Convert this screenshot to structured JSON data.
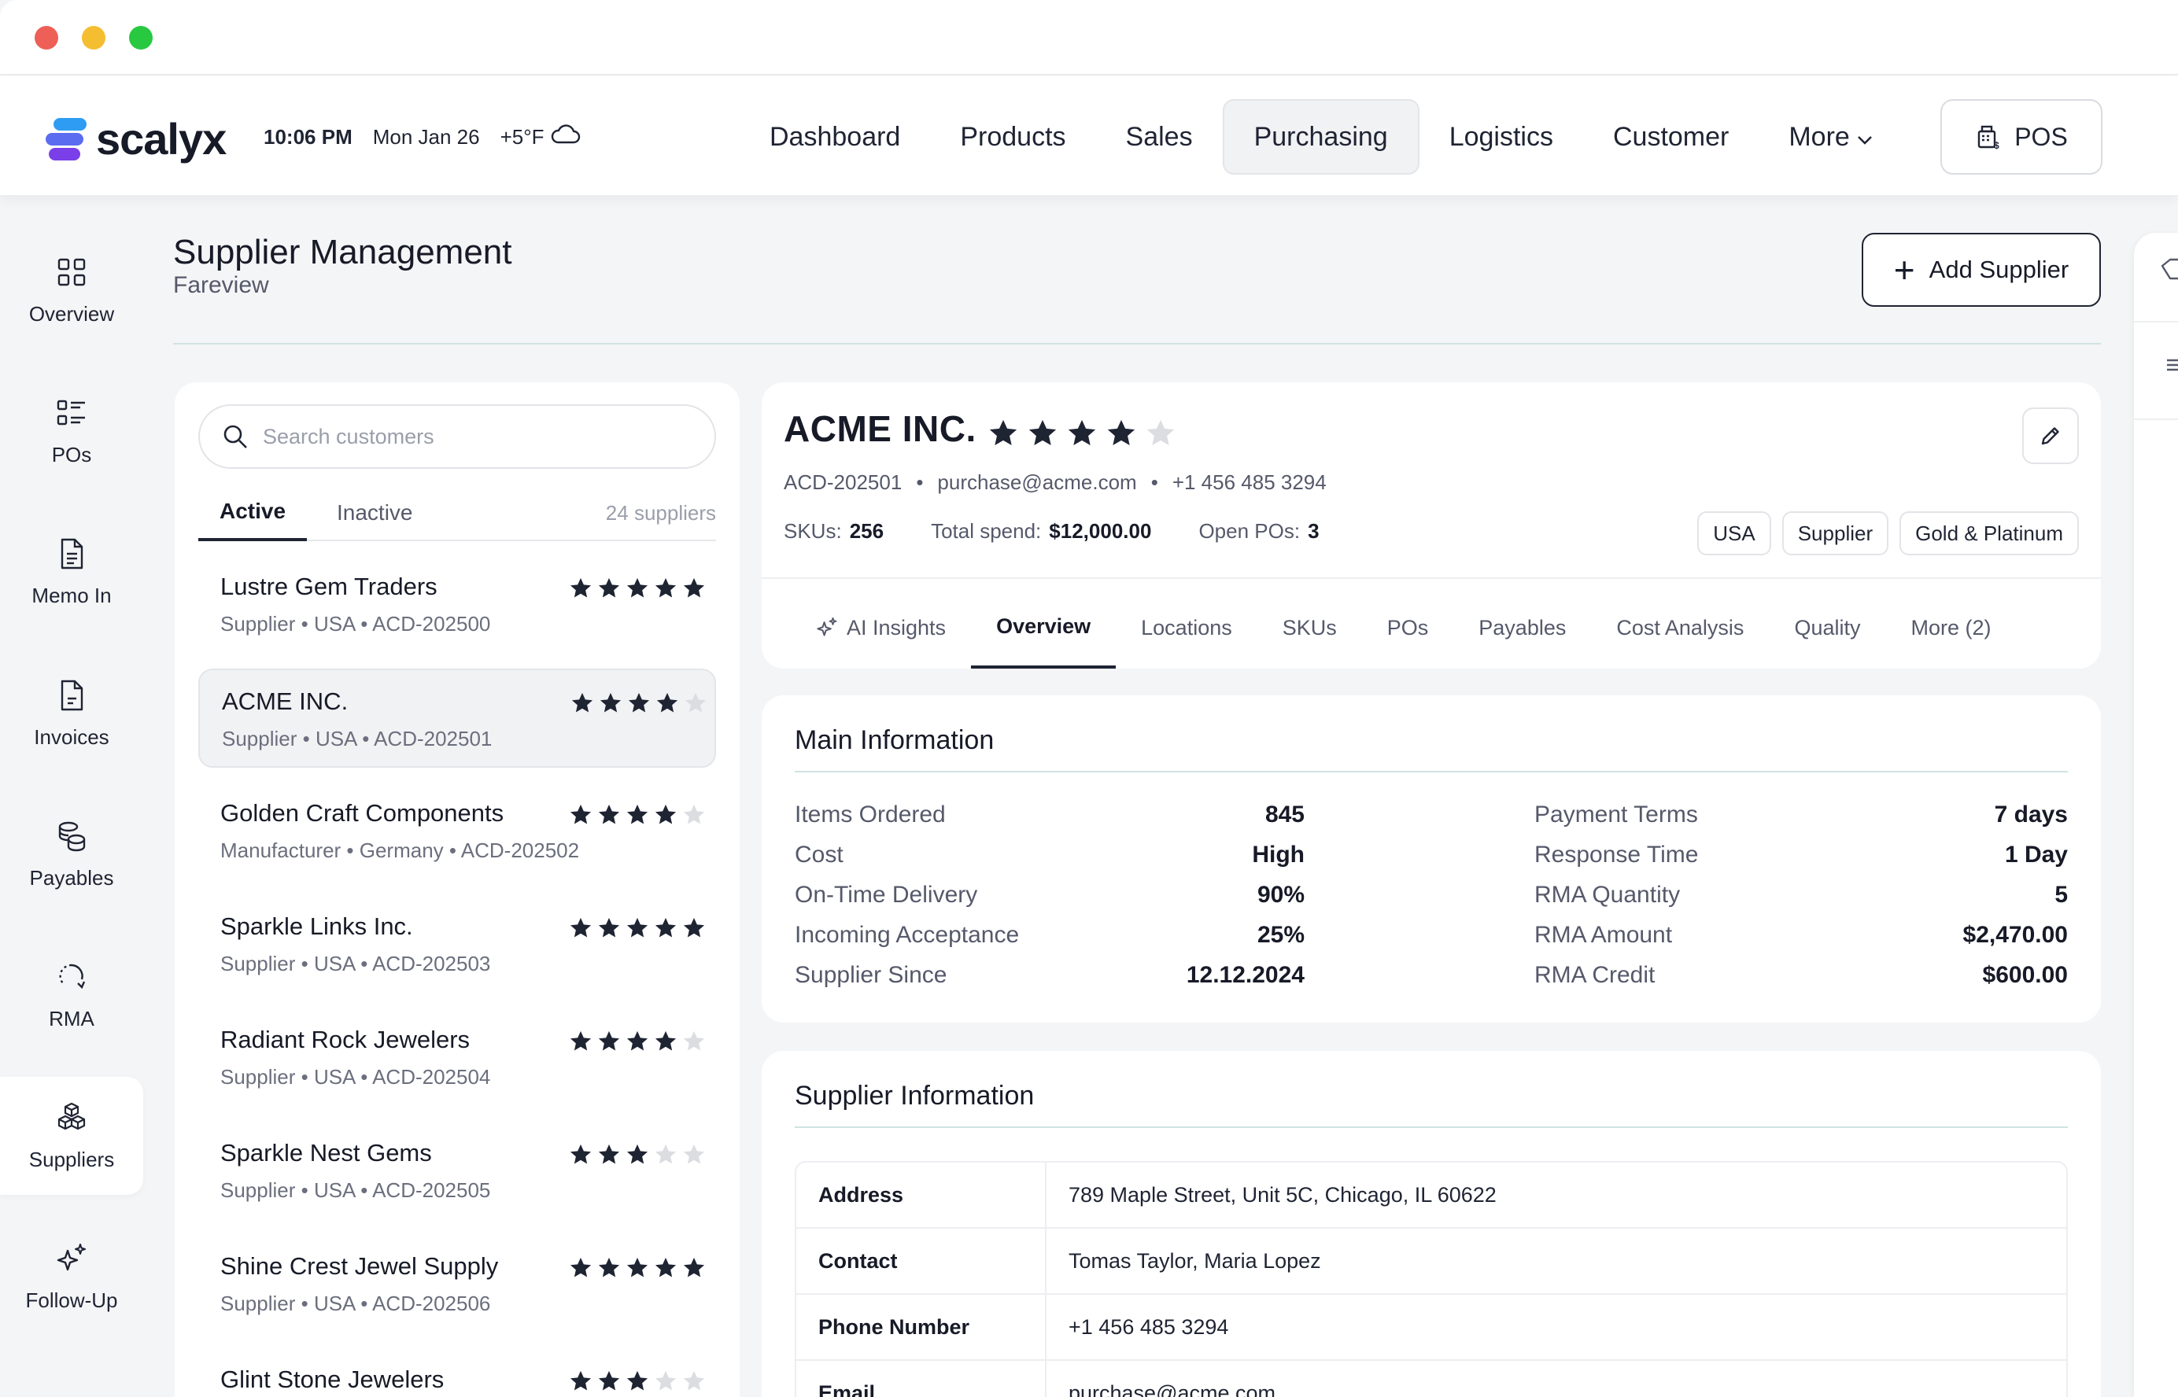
{
  "window": {
    "controls": [
      "close",
      "minimize",
      "maximize"
    ]
  },
  "brand": {
    "name": "scalyx",
    "colors": {
      "blue": "#2e9cf3",
      "indigo": "#5b6cf0",
      "purple": "#7a3fe8"
    }
  },
  "status": {
    "time": "10:06 PM",
    "date": "Mon Jan 26",
    "temp": "+5°F",
    "weather_icon": "cloud-icon"
  },
  "nav": {
    "items": [
      {
        "label": "Dashboard",
        "active": false
      },
      {
        "label": "Products",
        "active": false
      },
      {
        "label": "Sales",
        "active": false
      },
      {
        "label": "Purchasing",
        "active": true
      },
      {
        "label": "Logistics",
        "active": false
      },
      {
        "label": "Customer",
        "active": false
      },
      {
        "label": "More",
        "active": false
      }
    ],
    "pos_label": "POS"
  },
  "sidebar": {
    "items": [
      {
        "label": "Overview",
        "icon": "grid-icon"
      },
      {
        "label": "POs",
        "icon": "list-icon"
      },
      {
        "label": "Memo In",
        "icon": "document-icon"
      },
      {
        "label": "Invoices",
        "icon": "invoice-icon"
      },
      {
        "label": "Payables",
        "icon": "coins-icon"
      },
      {
        "label": "RMA",
        "icon": "return-icon"
      },
      {
        "label": "Suppliers",
        "icon": "boxes-icon",
        "active": true
      },
      {
        "label": "Follow-Up",
        "icon": "sparkle-icon"
      }
    ]
  },
  "page": {
    "title": "Supplier Management",
    "subtitle": "Fareview",
    "add_button": "Add Supplier"
  },
  "list": {
    "search_placeholder": "Search customers",
    "tabs": {
      "active": "Active",
      "inactive": "Inactive"
    },
    "count": "24 suppliers",
    "suppliers": [
      {
        "name": "Lustre Gem Traders",
        "meta": "Supplier • USA • ACD-202500",
        "rating": 5
      },
      {
        "name": "ACME INC.",
        "meta": "Supplier • USA • ACD-202501",
        "rating": 4,
        "active": true
      },
      {
        "name": "Golden Craft Components",
        "meta": "Manufacturer • Germany • ACD-202502",
        "rating": 4
      },
      {
        "name": "Sparkle Links Inc.",
        "meta": "Supplier • USA • ACD-202503",
        "rating": 5
      },
      {
        "name": "Radiant Rock Jewelers",
        "meta": "Supplier • USA • ACD-202504",
        "rating": 4
      },
      {
        "name": "Sparkle Nest Gems",
        "meta": "Supplier • USA • ACD-202505",
        "rating": 3
      },
      {
        "name": "Shine Crest Jewel Supply",
        "meta": "Supplier • USA • ACD-202506",
        "rating": 5
      },
      {
        "name": "Glint Stone Jewelers",
        "meta": "",
        "rating": 3
      }
    ]
  },
  "detail": {
    "name": "ACME INC.",
    "rating": 4,
    "id": "ACD-202501",
    "email": "purchase@acme.com",
    "phone": "+1 456 485 3294",
    "skus_label": "SKUs:",
    "skus": "256",
    "spend_label": "Total spend:",
    "spend": "$12,000.00",
    "open_pos_label": "Open POs:",
    "open_pos": "3",
    "chips": [
      "USA",
      "Supplier",
      "Gold & Platinum"
    ],
    "tabs": [
      "AI Insights",
      "Overview",
      "Locations",
      "SKUs",
      "POs",
      "Payables",
      "Cost Analysis",
      "Quality",
      "More (2)"
    ],
    "active_tab": "Overview"
  },
  "main_info": {
    "title": "Main Information",
    "left": [
      {
        "k": "Items Ordered",
        "v": "845"
      },
      {
        "k": "Cost",
        "v": "High"
      },
      {
        "k": "On-Time Delivery",
        "v": "90%"
      },
      {
        "k": "Incoming Acceptance",
        "v": "25%"
      },
      {
        "k": "Supplier Since",
        "v": "12.12.2024"
      }
    ],
    "right": [
      {
        "k": "Payment Terms",
        "v": "7 days"
      },
      {
        "k": "Response Time",
        "v": "1 Day"
      },
      {
        "k": "RMA Quantity",
        "v": "5"
      },
      {
        "k": "RMA Amount",
        "v": "$2,470.00"
      },
      {
        "k": "RMA Credit",
        "v": "$600.00"
      }
    ]
  },
  "supplier_info": {
    "title": "Supplier Information",
    "rows": [
      {
        "k": "Address",
        "v": "789 Maple Street, Unit 5C, Chicago, IL 60622"
      },
      {
        "k": "Contact",
        "v": "Tomas Taylor, Maria Lopez"
      },
      {
        "k": "Phone Number",
        "v": "+1 456 485 3294"
      },
      {
        "k": "Email",
        "v": "purchase@acme.com"
      }
    ]
  }
}
